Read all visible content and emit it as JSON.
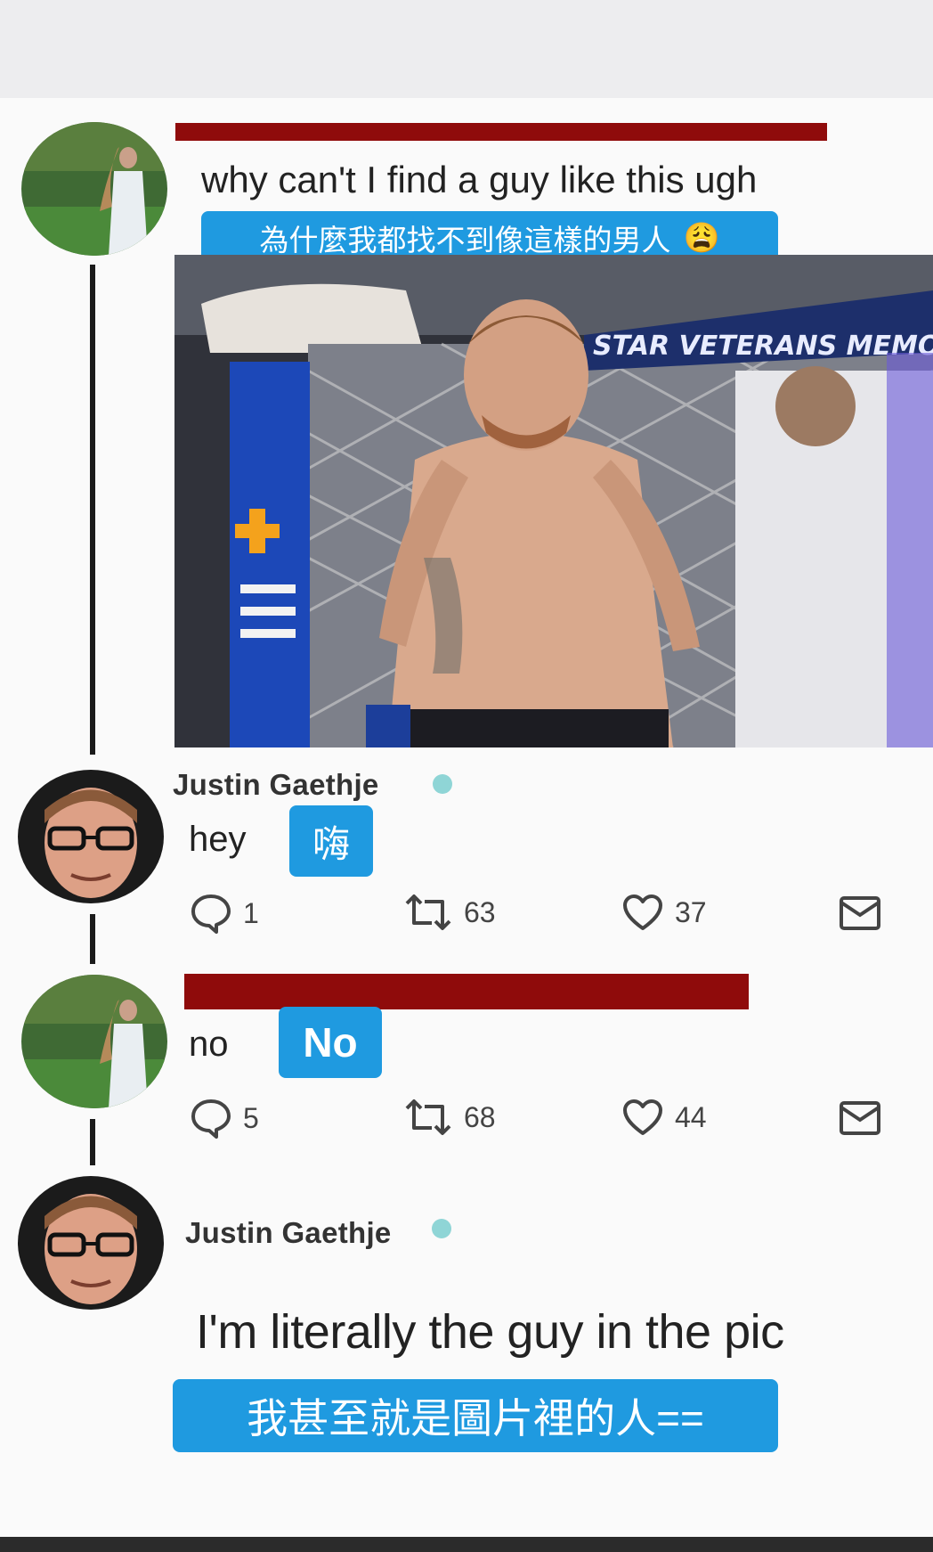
{
  "tweet1": {
    "text": "why can't I find a guy like this ugh",
    "translation": "為什麼我都找不到像這樣的男人",
    "emoji": "😩",
    "image_alt": "shirtless fighter standing in cage",
    "image_watermark": "STAR VETERANS MEMO"
  },
  "reply1": {
    "author": "Justin Gaethje",
    "text": "hey",
    "translation": "嗨",
    "replies": "1",
    "retweets": "63",
    "likes": "37"
  },
  "reply2": {
    "text": "no",
    "translation": "No",
    "replies": "5",
    "retweets": "68",
    "likes": "44"
  },
  "reply3": {
    "author": "Justin Gaethje",
    "text": "I'm literally the guy in the pic",
    "translation": "我甚至就是圖片裡的人=="
  },
  "colors": {
    "accent_blue": "#1f9ae0",
    "redaction": "#8f0b0b",
    "verified": "#8fd5d6"
  }
}
